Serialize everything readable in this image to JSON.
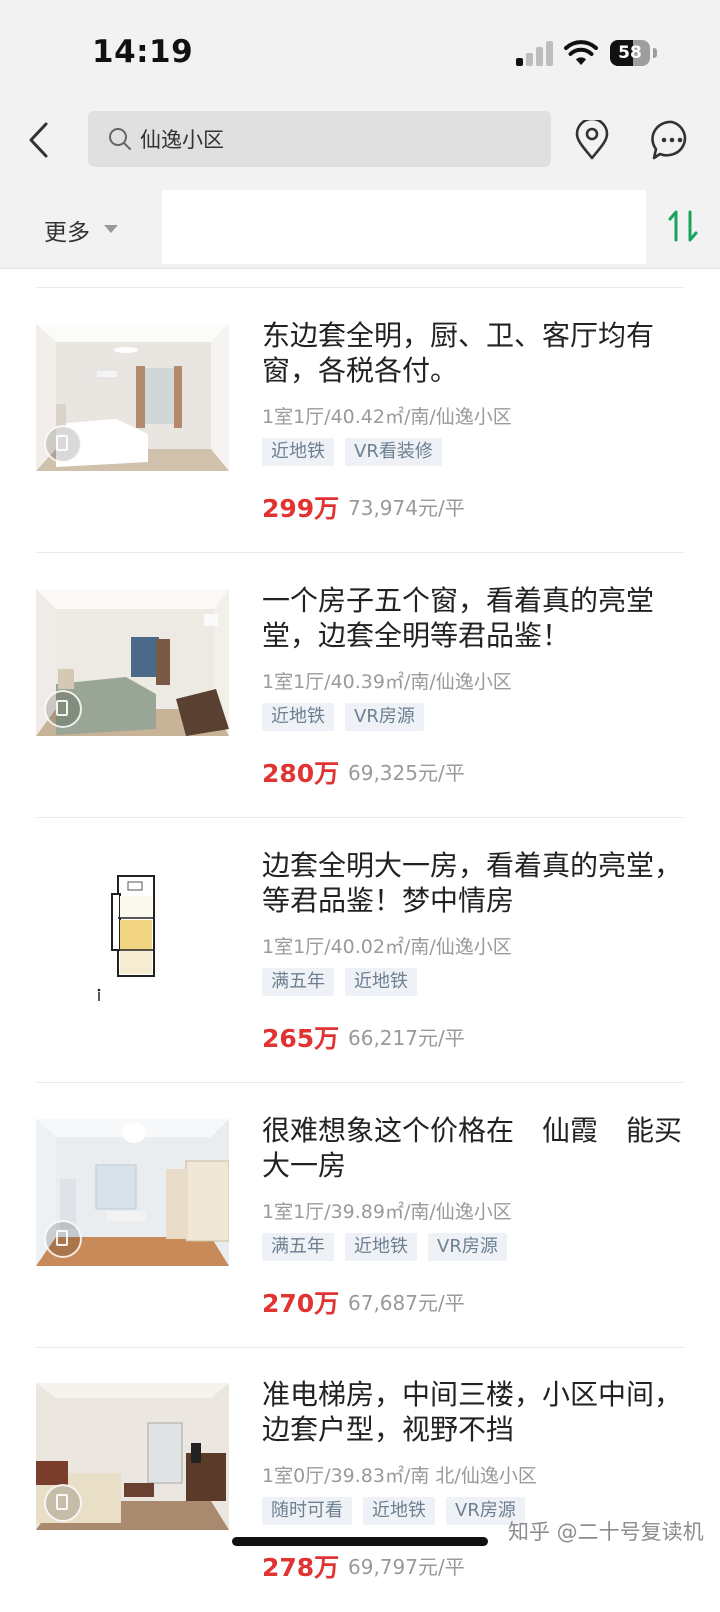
{
  "status_bar": {
    "time": "14:19",
    "battery": "58"
  },
  "search": {
    "query": "仙逸小区"
  },
  "filter": {
    "more_label": "更多"
  },
  "listings": [
    {
      "title": "东边套全明，厨、卫、客厅均有窗，各税各付。",
      "meta": "1室1厅/40.42㎡/南/仙逸小区",
      "tags": [
        "近地铁",
        "VR看装修"
      ],
      "price": "299万",
      "unit_price": "73,974元/平"
    },
    {
      "title": "一个房子五个窗，看着真的亮堂堂，边套全明等君品鉴！",
      "meta": "1室1厅/40.39㎡/南/仙逸小区",
      "tags": [
        "近地铁",
        "VR房源"
      ],
      "price": "280万",
      "unit_price": "69,325元/平"
    },
    {
      "title": "边套全明大一房，看着真的亮堂，等君品鉴！梦中情房",
      "meta": "1室1厅/40.02㎡/南/仙逸小区",
      "tags": [
        "满五年",
        "近地铁"
      ],
      "price": "265万",
      "unit_price": "66,217元/平"
    },
    {
      "title": "很难想象这个价格在　仙霞　能买大一房",
      "meta": "1室1厅/39.89㎡/南/仙逸小区",
      "tags": [
        "满五年",
        "近地铁",
        "VR房源"
      ],
      "price": "270万",
      "unit_price": "67,687元/平"
    },
    {
      "title": "准电梯房，中间三楼，小区中间，边套户型，视野不挡",
      "meta": "1室0厅/39.83㎡/南 北/仙逸小区",
      "tags": [
        "随时可看",
        "近地铁",
        "VR房源"
      ],
      "price": "278万",
      "unit_price": "69,797元/平"
    }
  ],
  "watermark": "知乎 @二十号复读机",
  "colors": {
    "price": "#e23333",
    "accent": "#1aa35a",
    "tag_bg": "#eef2f6"
  }
}
